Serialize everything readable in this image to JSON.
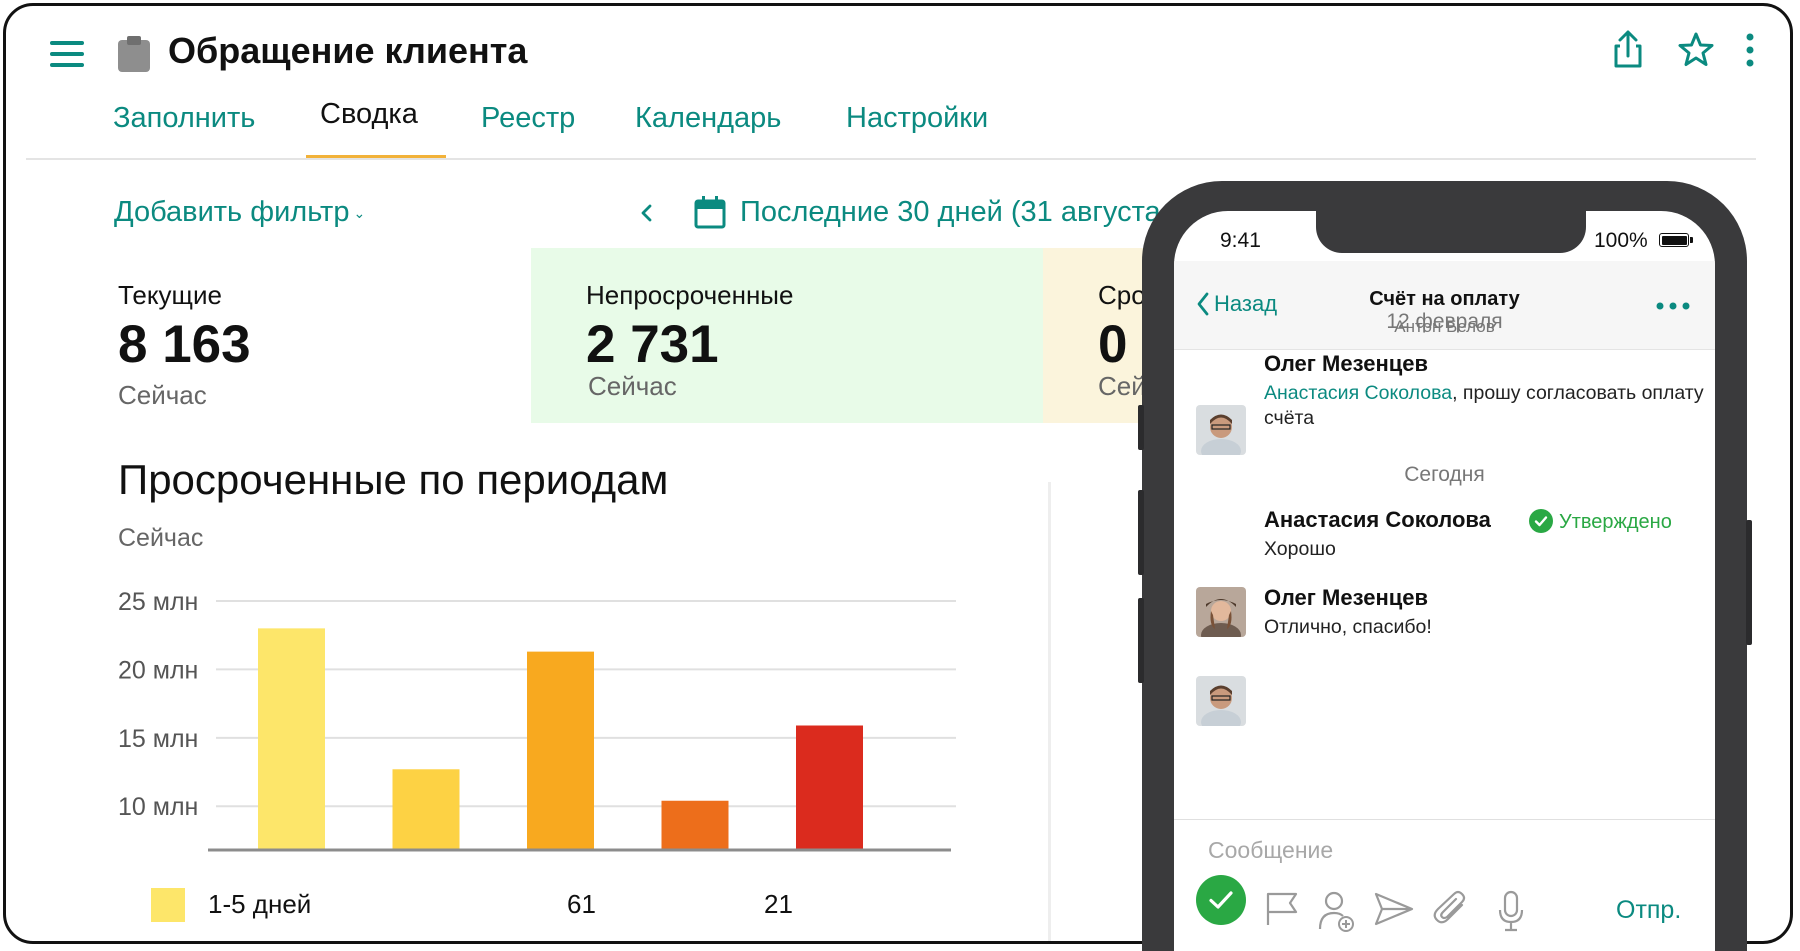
{
  "header": {
    "title": "Обращение клиента"
  },
  "tabs": [
    {
      "label": "Заполнить"
    },
    {
      "label": "Сводка"
    },
    {
      "label": "Реестр"
    },
    {
      "label": "Календарь"
    },
    {
      "label": "Настройки"
    }
  ],
  "filter": {
    "add_label": "Добавить фильтр",
    "period_label": "Последние 30 дней (31 августа –"
  },
  "kpis": [
    {
      "label": "Текущие",
      "value": "8 163",
      "sub": "Сейчас",
      "bg": "#ffffff"
    },
    {
      "label": "Непросроченные",
      "value": "2 731",
      "sub": "Сейчас",
      "bg": "#e8fbe8"
    },
    {
      "label": "Сро",
      "value": "0",
      "sub": "Сей",
      "bg": "#fbf4dc"
    }
  ],
  "chart_data": {
    "type": "bar",
    "title": "Просроченные по периодам",
    "subtitle": "Сейчас",
    "yticks": [
      "25 млн",
      "20 млн",
      "15 млн",
      "10 млн"
    ],
    "ytick_values": [
      25,
      20,
      15,
      10
    ],
    "ylim": [
      6.8,
      25
    ],
    "grid": true,
    "values": [
      23,
      12.7,
      21.3,
      10.4,
      15.9
    ],
    "colors": [
      "#fde66a",
      "#fdd244",
      "#f8a91f",
      "#ed6e1b",
      "#db2b1e"
    ],
    "legend": {
      "label": "1-5 дней",
      "extra": [
        "61",
        "21"
      ]
    }
  },
  "phone": {
    "time": "9:41",
    "battery": "100%",
    "back_label": "Назад",
    "chat_title": "Счёт на оплату",
    "chat_subtitle": "Антон Белов",
    "day1": "12 февраля",
    "day2": "Сегодня",
    "messages": [
      {
        "author": "Олег Мезенцев",
        "mention": "Анастасия Соколова",
        "text": ", прошу согласовать оплату счёта"
      },
      {
        "author": "Анастасия Соколова",
        "status": "Утверждено",
        "text": "Хорошо"
      },
      {
        "author": "Олег Мезенцев",
        "text": "Отлично, спасибо!"
      }
    ],
    "input_placeholder": "Сообщение",
    "send_label": "Отпр."
  },
  "colors": {
    "accent": "#0b8a80",
    "tab_underline": "#f2b23a",
    "approved": "#2aa844"
  },
  "icons": [
    "menu-icon",
    "clipboard-icon",
    "share-icon",
    "star-icon",
    "more-vertical-icon",
    "chevron-left-icon",
    "calendar-icon",
    "check-icon",
    "flag-icon",
    "add-user-icon",
    "send-icon",
    "paperclip-icon",
    "microphone-icon"
  ]
}
